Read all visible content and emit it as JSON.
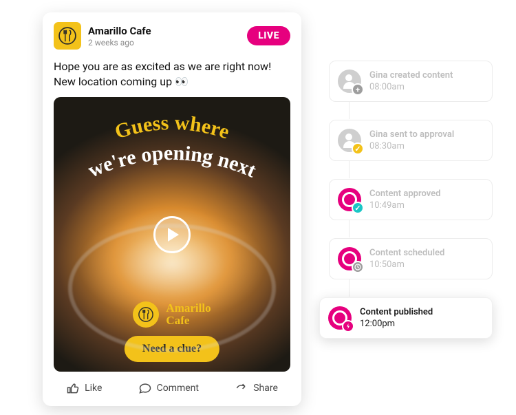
{
  "post": {
    "page_name": "Amarillo Cafe",
    "timestamp": "2 weeks ago",
    "live_badge": "LIVE",
    "body": "Hope you are as excited as we are right now! New location coming up 👀",
    "media": {
      "overlay_line1": "Guess where",
      "overlay_line2": "we're opening next",
      "brand_name_line1": "Amarillo",
      "brand_name_line2": "Cafe",
      "clue_button": "Need a clue?"
    },
    "actions": {
      "like": "Like",
      "comment": "Comment",
      "share": "Share"
    }
  },
  "timeline": [
    {
      "title": "Gina created content",
      "time": "08:00am",
      "icon": "avatar-grey",
      "sub": "plus",
      "active": false
    },
    {
      "title": "Gina sent to approval",
      "time": "08:30am",
      "icon": "avatar-grey",
      "sub": "check-yellow",
      "active": false
    },
    {
      "title": "Content approved",
      "time": "10:49am",
      "icon": "brand-pink",
      "sub": "check-teal",
      "active": false
    },
    {
      "title": "Content scheduled",
      "time": "10:50am",
      "icon": "brand-pink",
      "sub": "clock",
      "active": false
    },
    {
      "title": "Content published",
      "time": "12:00pm",
      "icon": "brand-pink",
      "sub": "bolt",
      "active": true
    }
  ]
}
